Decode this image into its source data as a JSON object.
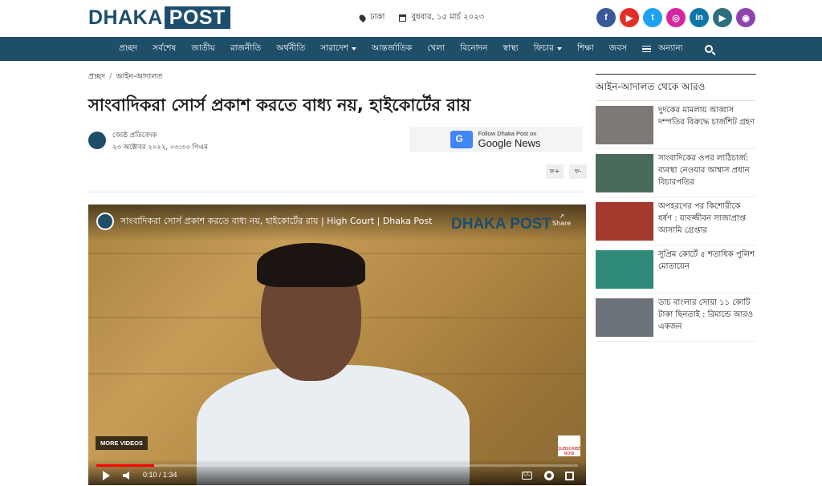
{
  "header": {
    "logo_left": "DHAKA",
    "logo_right": "POST",
    "location": "ঢাকা",
    "date": "বুধবার, ১৫ মার্চ ২০২৩",
    "socials": [
      {
        "icon": "facebook-icon",
        "glyph": "f",
        "color": "#3b5998"
      },
      {
        "icon": "youtube-icon",
        "glyph": "▶",
        "color": "#e52d27"
      },
      {
        "icon": "twitter-icon",
        "glyph": "t",
        "color": "#1da1f2"
      },
      {
        "icon": "instagram-icon",
        "glyph": "◎",
        "color": "#d6249f"
      },
      {
        "icon": "linkedin-icon",
        "glyph": "in",
        "color": "#0e76a8"
      },
      {
        "icon": "google-play-icon",
        "glyph": "▶",
        "color": "#2d6e7e"
      },
      {
        "icon": "podcast-icon",
        "glyph": "◉",
        "color": "#8e44ad"
      }
    ]
  },
  "nav": {
    "items": [
      "প্রচ্ছদ",
      "সর্বশেষ",
      "জাতীয়",
      "রাজনীতি",
      "অর্থনীতি",
      "সারাদেশ",
      "আন্তর্জাতিক",
      "খেলা",
      "বিনোদন",
      "স্বাস্থ্য",
      "ফিচার",
      "শিক্ষা",
      "জবস",
      "অন্যান্য"
    ]
  },
  "article": {
    "breadcrumb_home": "প্রচ্ছদ",
    "breadcrumb_section": "আইন-আদালত",
    "headline": "সাংবাদিকরা সোর্স প্রকাশ করতে বাধ্য নয়, হাইকোর্টের রায়",
    "author": "জ্যেষ্ঠ প্রতিবেদক",
    "published": "২৩ অক্টোবর ২০২২, ০৩:৩৩ পিএম",
    "gnews_follow": "Follow Dhaka Post on",
    "gnews_name": "Google News",
    "font_increase": "ফ+",
    "font_decrease": "ফ-"
  },
  "video": {
    "title": "সাংবাদিকরা সোর্স প্রকাশ করতে বাধ্য নয়, হাইকোর্টের রায় | High Court | Dhaka Post",
    "brand": "DHAKA POST",
    "share_label": "Share",
    "more_videos": "MORE VIDEOS",
    "badge": "SUBSCRIBE NOW",
    "time": "0:10 / 1:34",
    "progress": 0.12,
    "cc_label": "CC"
  },
  "sidebar": {
    "heading": "আইন-আদালত থেকে আরও",
    "items": [
      {
        "title": "দুদকের মামলায় আব্বাস দম্পতির বিরুদ্ধে চার্জশিট গ্রহণ",
        "thumb_color": "#7d7a76"
      },
      {
        "title": "সাংবাদিকের ওপর লাঠিচার্জ: ব্যবস্থা নেওয়ার আশ্বাস প্রধান বিচারপতির",
        "thumb_color": "#4a6b5c"
      },
      {
        "title": "অপহরণের পর কিশোরীকে ধর্ষণ : যাবজ্জীবন সাজাপ্রাপ্ত আসামি গ্রেপ্তার",
        "thumb_color": "#a33a2e"
      },
      {
        "title": "সুপ্রিম কোর্টে ৫ শতাধিক পুলিশ মোতায়েন",
        "thumb_color": "#2f8a7a"
      },
      {
        "title": "ডাচ বাংলার সোয়া ১১ কোটি টাকা ছিনতাই : রিমান্ডে আরও একজন",
        "thumb_color": "#6d737a"
      }
    ]
  }
}
